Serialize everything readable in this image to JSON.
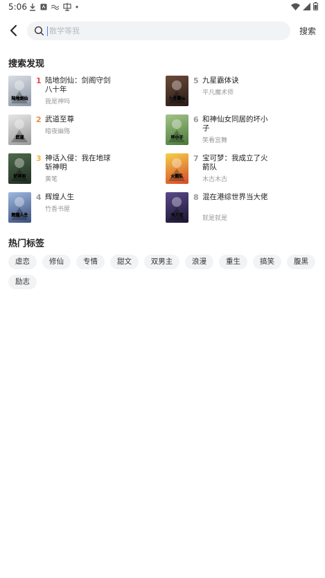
{
  "status_bar": {
    "time": "5:06",
    "left_icons": [
      "download-icon",
      "app-badge-icon",
      "wave-icon",
      "app-icon",
      "dot-icon"
    ],
    "right_icons": [
      "wifi-icon",
      "signal-icon",
      "battery-icon"
    ]
  },
  "header": {
    "search_placeholder": "散学等我",
    "search_button": "搜索"
  },
  "discovery": {
    "title": "搜索发现",
    "books": [
      {
        "rank": "1",
        "title": "陆地剑仙：剑阁守剑八十年",
        "author": "我是神吗",
        "rank_color": "#e64a4a",
        "cover_colors": [
          "#d9dde3",
          "#8b96a6"
        ],
        "cover_text": "陆地剑仙"
      },
      {
        "rank": "2",
        "title": "武道至尊",
        "author": "暗夜幽殇",
        "rank_color": "#f08a3c",
        "cover_colors": [
          "#e6e6e6",
          "#9a9a9a"
        ],
        "cover_text": "武道"
      },
      {
        "rank": "3",
        "title": "神话入侵：我在地球斩神明",
        "author": "黄笔",
        "rank_color": "#f2b63c",
        "cover_colors": [
          "#4e6b4c",
          "#1f2d21"
        ],
        "cover_text": "斩神明"
      },
      {
        "rank": "4",
        "title": "辉煌人生",
        "author": "竹香书屋",
        "rank_color": "#999999",
        "cover_colors": [
          "#9fb8e0",
          "#3a4f7a"
        ],
        "cover_text": "辉煌人生"
      },
      {
        "rank": "5",
        "title": "九星霸体诀",
        "author": "平凡魔术师",
        "rank_color": "#999999",
        "cover_colors": [
          "#6b4a3a",
          "#2a1c16"
        ],
        "cover_text": "九星霸体"
      },
      {
        "rank": "6",
        "title": "和神仙女同居的坏小子",
        "author": "笑看宫舞",
        "rank_color": "#999999",
        "cover_colors": [
          "#a3c48a",
          "#4a7a38"
        ],
        "cover_text": "坏小子"
      },
      {
        "rank": "7",
        "title": "宝可梦：我成立了火箭队",
        "author": "木古木古",
        "rank_color": "#999999",
        "cover_colors": [
          "#f5d04a",
          "#d44a2a"
        ],
        "cover_text": "火箭队"
      },
      {
        "rank": "8",
        "title": "混在港综世界当大佬",
        "author": "就是就是",
        "rank_color": "#999999",
        "cover_colors": [
          "#5a4a8a",
          "#1a1530"
        ],
        "cover_text": "当大佬"
      }
    ]
  },
  "hot_tags": {
    "title": "热门标签",
    "tags": [
      "虐恋",
      "修仙",
      "专情",
      "甜文",
      "双男主",
      "浪漫",
      "重生",
      "搞笑",
      "腹黑",
      "励志"
    ]
  }
}
